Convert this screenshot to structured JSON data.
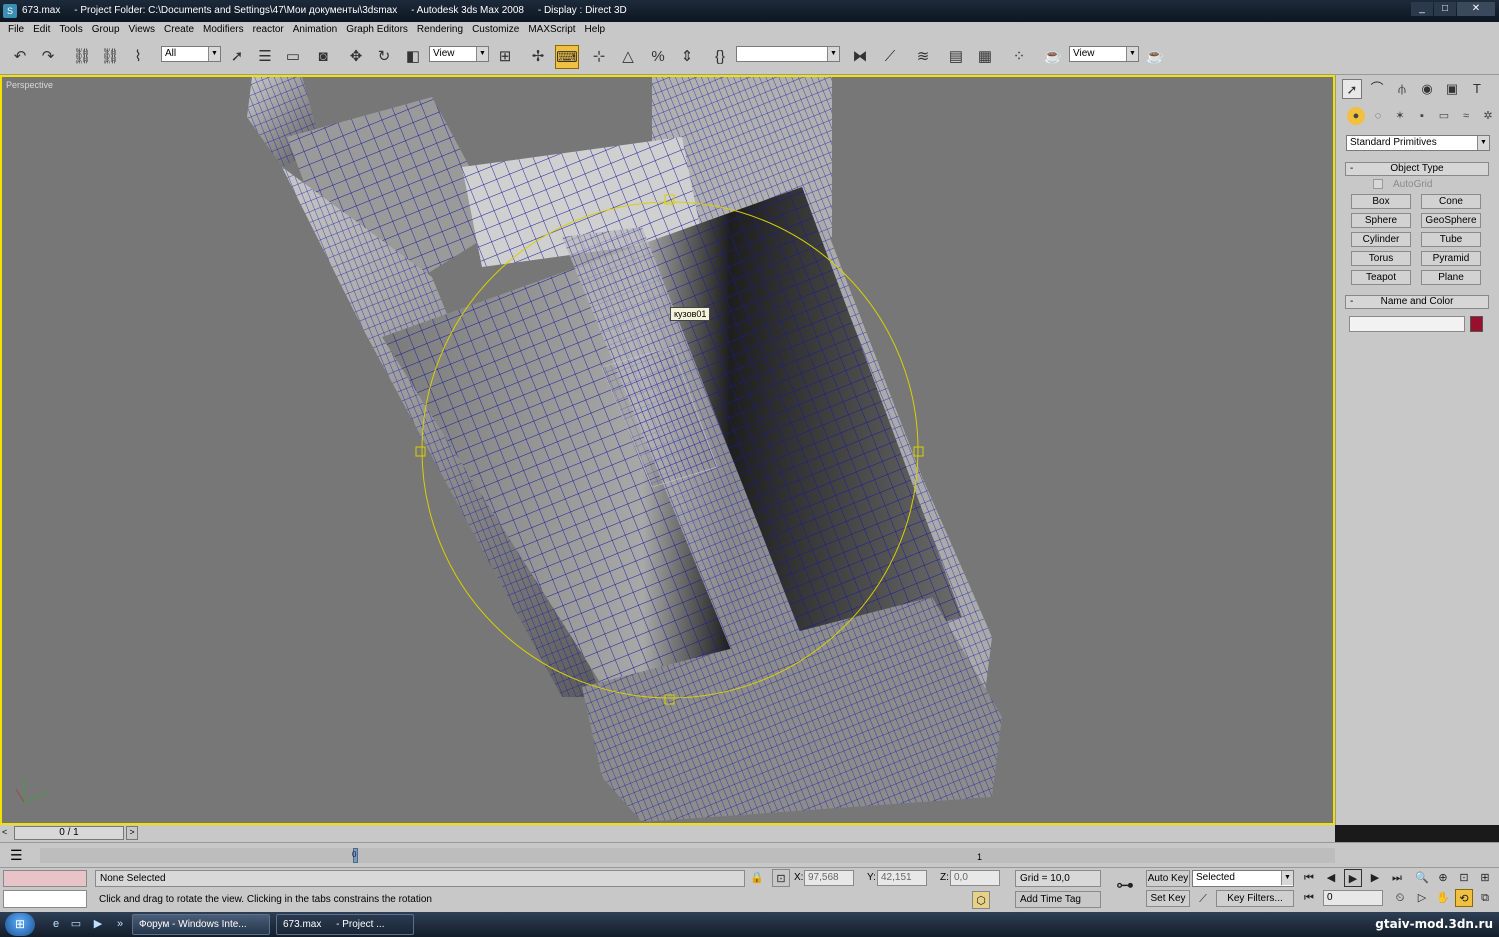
{
  "window": {
    "title": "673.max     - Project Folder: C:\\Documents and Settings\\47\\Мои документы\\3dsmax     - Autodesk 3ds Max 2008     - Display : Direct 3D",
    "app_icon": "3dsmax-icon",
    "minimize": "_",
    "maximize": "□",
    "close": "✕"
  },
  "menu": [
    "File",
    "Edit",
    "Tools",
    "Group",
    "Views",
    "Create",
    "Modifiers",
    "reactor",
    "Animation",
    "Graph Editors",
    "Rendering",
    "Customize",
    "MAXScript",
    "Help"
  ],
  "toolbar": {
    "selection_filter": "All",
    "reference_coord": "View",
    "named_selection": "",
    "render_view": "View"
  },
  "viewport": {
    "label": "Perspective",
    "object_tooltip": "кузов01"
  },
  "command_panel": {
    "category": "Standard Primitives",
    "object_type_title": "Object Type",
    "autogrid": "AutoGrid",
    "buttons": [
      "Box",
      "Cone",
      "Sphere",
      "GeoSphere",
      "Cylinder",
      "Tube",
      "Torus",
      "Pyramid",
      "Teapot",
      "Plane"
    ],
    "name_color_title": "Name and Color",
    "name_value": "",
    "object_color": "#9a0f2e"
  },
  "timeline": {
    "frame_display": "0 / 1",
    "marker_0": "0",
    "marker_1": "1"
  },
  "status": {
    "selection": "None Selected",
    "prompt": "Click and drag to rotate the view.  Clicking in the tabs constrains the rotation",
    "x_label": "X:",
    "x_value": "97,568",
    "y_label": "Y:",
    "y_value": "42,151",
    "z_label": "Z:",
    "z_value": "0,0",
    "grid": "Grid = 10,0",
    "add_time_tag": "Add Time Tag",
    "auto_key": "Auto Key",
    "set_key": "Set Key",
    "key_mode": "Selected",
    "key_filters": "Key Filters...",
    "current_frame": "0"
  },
  "taskbar": {
    "tasks": [
      "Форум - Windows Inte...",
      "673.max",
      "- Project ..."
    ],
    "watermark": "gtaiv-mod.3dn.ru"
  }
}
